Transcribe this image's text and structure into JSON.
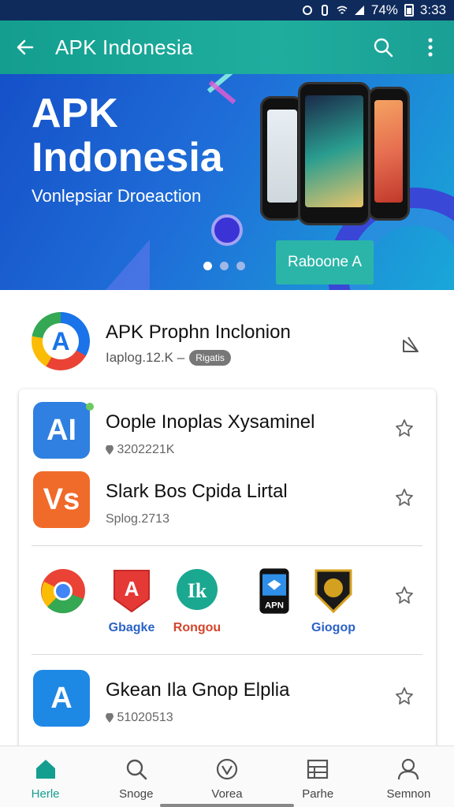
{
  "status_bar": {
    "battery": "74%",
    "time": "3:33"
  },
  "app_bar": {
    "title": "APK Indonesia",
    "back_icon": "arrow-left-icon",
    "search_icon": "search-icon",
    "menu_icon": "more-vert-icon"
  },
  "banner": {
    "title_line1": "APK",
    "title_line2": "Indonesia",
    "subtitle": "Vonlepsiar Droeaction",
    "button_label": "Raboone A",
    "dots": 3,
    "active_dot": 0
  },
  "app_header": {
    "name": "APK Prophn Inclonion",
    "meta": "Iaplog.12.K  –",
    "badge": "Rigatis",
    "share_icon": "share-icon"
  },
  "list": [
    {
      "title": "Oople Inoplas Xysaminel",
      "subtitle": "3202221K",
      "icon_text": "AI",
      "icon_color": "#2f80e0",
      "has_pin": true
    },
    {
      "title": "Slark Bos Cpida Lirtal",
      "subtitle": "Splog.2713",
      "icon_text": "Vs",
      "icon_color": "#f06a2a",
      "has_pin": false
    },
    {
      "title": "Gkean Ila Gnop Elplia",
      "subtitle": "51020513",
      "icon_text": "A",
      "icon_color": "#1e88e5",
      "has_pin": true
    }
  ],
  "mini_apps": [
    {
      "label": "Gbagke",
      "icon": "chrome-icon",
      "label_color": "#2b62c8"
    },
    {
      "label": "",
      "icon": "shield-a-icon",
      "label_color": "#d32f2f"
    },
    {
      "label": "Rongou",
      "icon": "ik-icon",
      "label_color": "#d4442a"
    },
    {
      "label": "APN",
      "icon": "phone-apn-icon",
      "label_color": "#111111"
    },
    {
      "label": "Giogop",
      "icon": "badge-gold-icon",
      "label_color": "#2b62c8"
    }
  ],
  "bottom_nav": [
    {
      "label": "Herle",
      "icon": "home-icon",
      "active": true
    },
    {
      "label": "Snoge",
      "icon": "search-icon",
      "active": false
    },
    {
      "label": "Vorea",
      "icon": "heart-icon",
      "active": false
    },
    {
      "label": "Parhe",
      "icon": "list-icon",
      "active": false
    },
    {
      "label": "Semnon",
      "icon": "person-icon",
      "active": false
    }
  ],
  "colors": {
    "primary": "#139e8f",
    "banner_start": "#1550c8",
    "banner_end": "#1aa7d8"
  }
}
